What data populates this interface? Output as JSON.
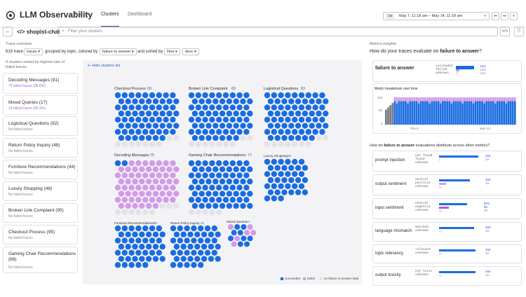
{
  "header": {
    "app_title": "LLM Observability",
    "tabs": [
      {
        "label": "Traces"
      },
      {
        "label": "Clusters"
      },
      {
        "label": "Dashboard"
      }
    ],
    "time_chip": "1w",
    "time_range": "May 7, 11:18 am – May 14, 11:18 am",
    "time_buttons": [
      "⏮",
      "⏭",
      "⏸"
    ]
  },
  "search": {
    "app_name": "</> shopist-chat",
    "placeholder": "Filter your clusters"
  },
  "controls": {
    "section_label": "Trace overview",
    "trace_count": "619 trace",
    "field": "inputs",
    "grouped_text": "grouped by topic, colored by",
    "color_by": "failure to answer",
    "sorted_text": "and sorted by",
    "sort_field": "time",
    "sort_dir": "desc",
    "clusters_summary": "9 clusters sorted by highest rate of failed traces"
  },
  "clusters": [
    {
      "title": "Decoding Messages (91)",
      "sub": "75 failed traces (86.8%)",
      "failed": true
    },
    {
      "title": "Mixed Queries (17)",
      "sub": "14 failed traces (82.4%)",
      "failed": true
    },
    {
      "title": "Logistical Questions (92)",
      "sub": "No failed traces",
      "failed": false
    },
    {
      "title": "Return Policy Inquiry (48)",
      "sub": "No failed traces",
      "failed": false
    },
    {
      "title": "Furniture Recommendations (44)",
      "sub": "No failed traces",
      "failed": false
    },
    {
      "title": "Luxury Shopping (48)",
      "sub": "No failed traces",
      "failed": false
    },
    {
      "title": "Broken Link Complaint (95)",
      "sub": "No failed traces",
      "failed": false
    },
    {
      "title": "Checkout Process (95)",
      "sub": "No failed traces",
      "failed": false
    },
    {
      "title": "Gaming Chair Recommendations (89)",
      "sub": "No failed traces",
      "failed": false
    }
  ],
  "viz": {
    "hide_list_label": "Hide clusters list",
    "groups": [
      {
        "title": "Checkout Process",
        "count": "83"
      },
      {
        "title": "Broken Link Complaint",
        "count": "83"
      },
      {
        "title": "Logistical Questions",
        "count": "83"
      },
      {
        "title": "Decoding Messages",
        "count": "75"
      },
      {
        "title": "Gaming Chair Recommendations",
        "count": "77"
      },
      {
        "title": "Luxury Shopping",
        "count": "83"
      },
      {
        "title": "Furniture Recommendations",
        "count": "39"
      },
      {
        "title": "Return Policy Inquiry",
        "count": "42"
      },
      {
        "title": "Mixed Queries",
        "count": "14"
      }
    ],
    "legend": [
      "succeeded",
      "failed",
      "no failure to answer data"
    ]
  },
  "colors": {
    "succeeded": "#1a6ce0",
    "failed": "#d29ae8",
    "no_data": "#e2e2e8",
    "accent": "#632ca6"
  },
  "insights": {
    "section_label": "Metrics insights",
    "question_prefix": "How do your traces evaluate on",
    "question_metric": "failure to answer",
    "question_suffix": "?",
    "main_metric": {
      "name": "failure to answer",
      "labels": [
        "succeeded",
        "failed",
        "unknown"
      ],
      "pcts": [
        "13%",
        "13%",
        "13%"
      ]
    },
    "chart_title": "Metric breakdown over time",
    "y_ticks": [
      "100",
      "50",
      "0"
    ],
    "x_ticks": [
      "Thu 9",
      "Mon 13"
    ],
    "dist_prefix": "How do",
    "dist_metric": "failure to answer",
    "dist_suffix": "evaluations distribute across other metrics?",
    "metrics": [
      {
        "name": "prompt injection",
        "labels": [
          "not found",
          "found",
          "unknown"
        ],
        "pcts": [
          "450",
          "19"
        ]
      },
      {
        "name": "output sentiment",
        "labels": [
          "neutral",
          "positive",
          "unknown"
        ],
        "pcts": [
          "450",
          "19"
        ]
      },
      {
        "name": "input sentiment",
        "labels": [
          "neutral",
          "negative",
          "unknown"
        ],
        "pcts": [
          "$75",
          "$3",
          "19"
        ]
      },
      {
        "name": "language mismatch",
        "labels": [
          "matched",
          "unknown"
        ],
        "pcts": [
          "450",
          "19"
        ]
      },
      {
        "name": "topic relevancy",
        "labels": [
          "relevant",
          "unknown"
        ],
        "pcts": [
          "450",
          "19"
        ]
      },
      {
        "name": "output toxicity",
        "labels": [
          "not toxic",
          "unknown"
        ],
        "pcts": [
          "450",
          "19"
        ]
      }
    ]
  }
}
